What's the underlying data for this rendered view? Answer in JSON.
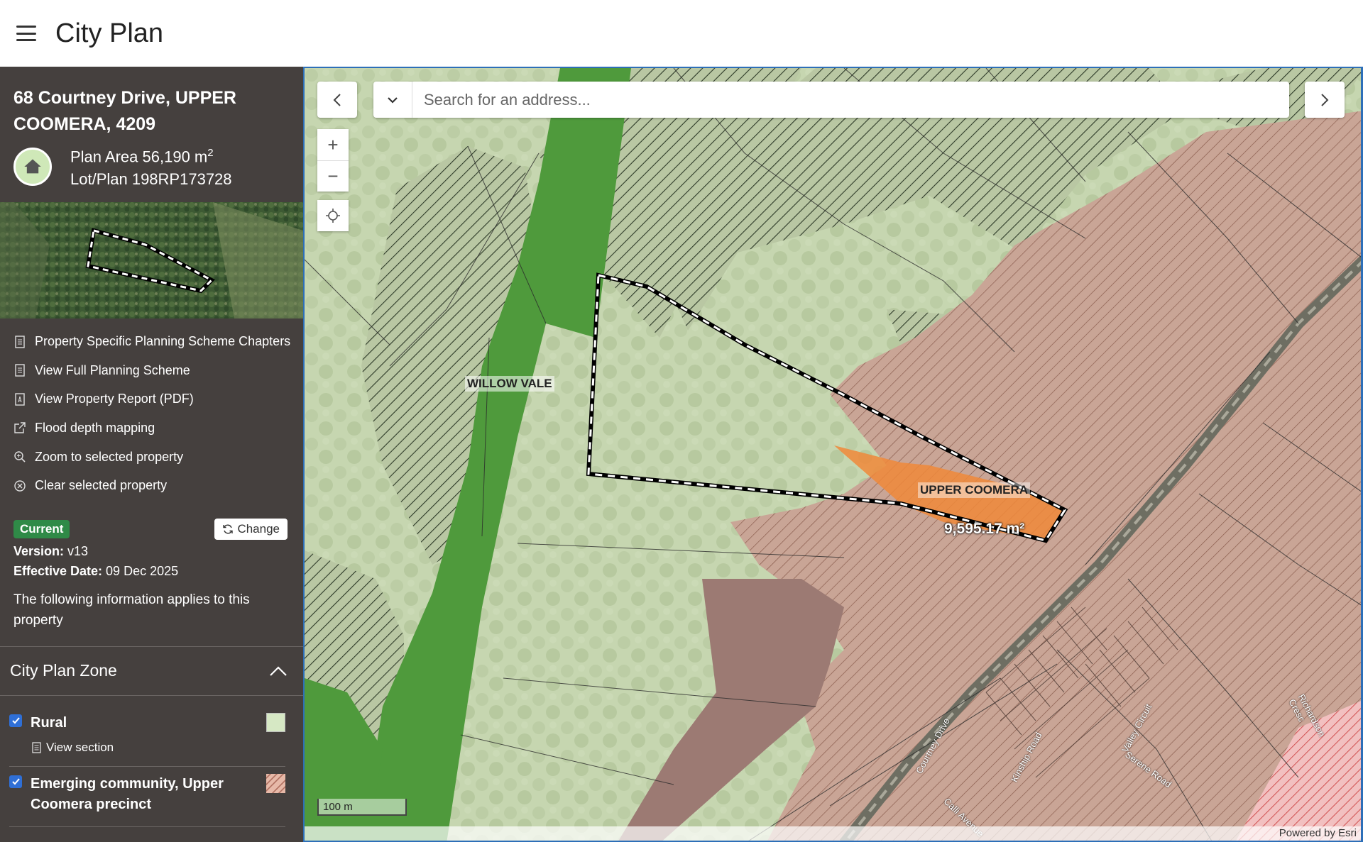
{
  "app": {
    "title": "City Plan"
  },
  "property": {
    "address": "68 Courtney Drive, UPPER COOMERA, 4209",
    "plan_area_label": "Plan Area 56,190 m",
    "plan_area_sup": "2",
    "lot_plan": "Lot/Plan 198RP173728"
  },
  "links": [
    {
      "label": "Property Specific Planning Scheme Chapters",
      "icon": "document-icon"
    },
    {
      "label": "View Full Planning Scheme",
      "icon": "document-icon"
    },
    {
      "label": "View Property Report (PDF)",
      "icon": "pdf-icon"
    },
    {
      "label": "Flood depth mapping",
      "icon": "external-link-icon"
    },
    {
      "label": "Zoom to selected property",
      "icon": "zoom-in-icon"
    },
    {
      "label": "Clear selected property",
      "icon": "clear-circle-icon"
    }
  ],
  "version": {
    "badge": "Current",
    "change_label": "Change",
    "version_label": "Version:",
    "version_value": " v13",
    "effective_label": "Effective Date:",
    "effective_value": " 09 Dec 2025",
    "applies_text": "The following information applies to this property"
  },
  "zone_panel": {
    "title": "City Plan Zone",
    "items": [
      {
        "name": "Rural",
        "checked": true,
        "swatch_color": "#d6e8c4",
        "view_label": "View section"
      },
      {
        "name": "Emerging community, Upper Coomera precinct",
        "checked": true,
        "swatch_color": "#e7b9a8"
      }
    ]
  },
  "map": {
    "search_placeholder": "Search for an address...",
    "zoom_in": "+",
    "zoom_out": "−",
    "scale_label": "100 m",
    "attribution": "Powered by Esri",
    "labels": {
      "willow_vale": "WILLOW VALE",
      "upper_coomera": "UPPER COOMERA",
      "area": "9,595.17 m²",
      "courtney_drive": "Courtney Drive",
      "kinship_road": "Kinship Road",
      "valley_circuit": "Valley Circuit",
      "serene_road": "Serene Road",
      "richardson_cresc": "Richardson Cresc",
      "calli_avenue": "Calli Avenue"
    },
    "colors": {
      "rural": "#cfdcb8",
      "green_corridor": "#4f9a3c",
      "emerging": "#c9a08f",
      "selection": "#f0883a",
      "highlight_border": "#2d6fb8"
    }
  }
}
